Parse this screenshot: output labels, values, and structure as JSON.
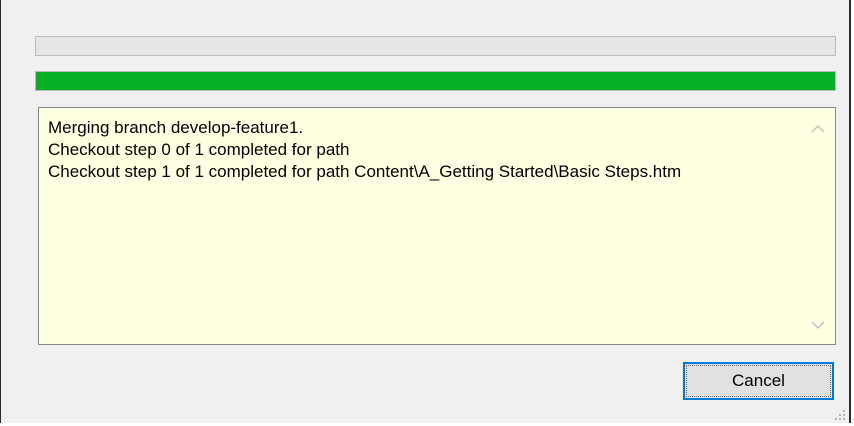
{
  "progress": {
    "top_bar_fraction": 0.0,
    "bottom_bar_fraction": 1.0,
    "fill_color": "#06b025"
  },
  "log": {
    "lines": [
      "Merging branch develop-feature1.",
      "Checkout step 0 of 1 completed for path",
      "Checkout step 1 of 1 completed for path Content\\A_Getting Started\\Basic Steps.htm"
    ],
    "background_color": "#ffffe1"
  },
  "icons": {
    "scroll_up": "chevron-up-icon",
    "scroll_down": "chevron-down-icon",
    "resize_grip": "resize-grip-icon"
  },
  "buttons": {
    "cancel_label": "Cancel",
    "focus_border_color": "#0078d7"
  }
}
